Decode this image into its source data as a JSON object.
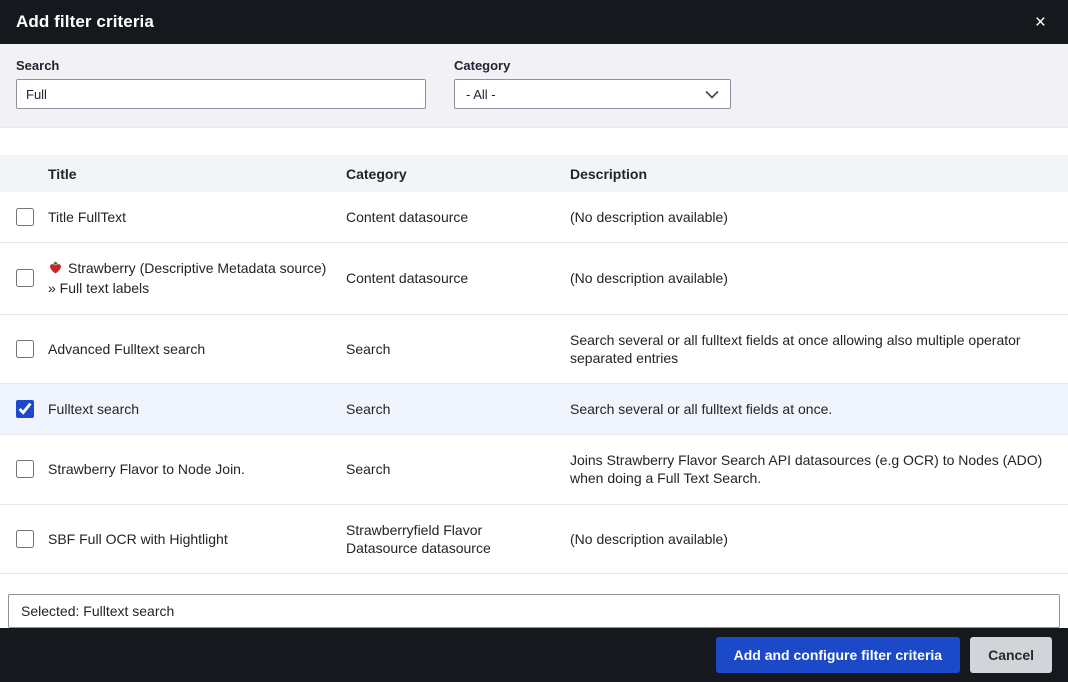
{
  "modal": {
    "title": "Add filter criteria",
    "close_icon": "×"
  },
  "filters": {
    "search_label": "Search",
    "search_value": "Full",
    "category_label": "Category",
    "category_value": "- All -"
  },
  "table": {
    "headers": [
      "Title",
      "Category",
      "Description"
    ],
    "rows": [
      {
        "checked": false,
        "title": "Title FullText",
        "category": "Content datasource",
        "description": "(No description available)"
      },
      {
        "checked": false,
        "icon": "strawberry-icon",
        "title": "Strawberry (Descriptive Metadata source) » Full text labels",
        "category": "Content datasource",
        "description": "(No description available)"
      },
      {
        "checked": false,
        "title": "Advanced Fulltext search",
        "category": "Search",
        "description": "Search several or all fulltext fields at once allowing also multiple operator separated entries"
      },
      {
        "checked": true,
        "highlighted": true,
        "title": "Fulltext search",
        "category": "Search",
        "description": "Search several or all fulltext fields at once."
      },
      {
        "checked": false,
        "title": "Strawberry Flavor to Node Join.",
        "category": "Search",
        "description": "Joins Strawberry Flavor Search API datasources (e.g OCR) to Nodes (ADO) when doing a Full Text Search."
      },
      {
        "checked": false,
        "title": "SBF Full OCR with Hightlight",
        "category": "Strawberryfield Flavor Datasource datasource",
        "description": "(No description available)"
      }
    ],
    "selected_text": "Selected: Fulltext search"
  },
  "footer": {
    "primary_label": "Add and configure filter criteria",
    "cancel_label": "Cancel"
  },
  "colors": {
    "header_bg": "#15181c",
    "accent": "#1b49c8",
    "selected_row_bg": "#f0f5fd",
    "cancel_bg": "#d3d4d9"
  }
}
